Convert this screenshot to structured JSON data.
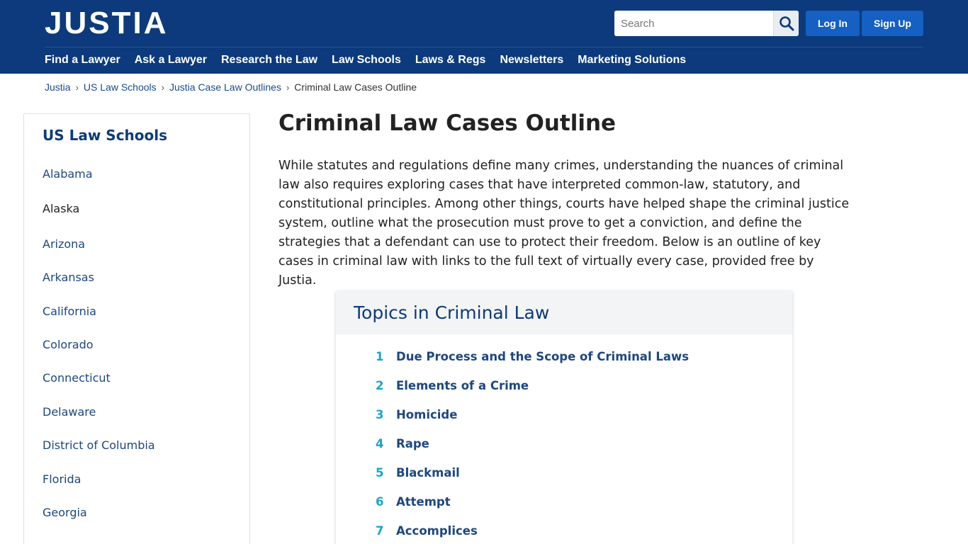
{
  "header": {
    "logo": "JUSTIA",
    "search_placeholder": "Search",
    "login_label": "Log In",
    "signup_label": "Sign Up",
    "nav": [
      "Find a Lawyer",
      "Ask a Lawyer",
      "Research the Law",
      "Law Schools",
      "Laws & Regs",
      "Newsletters",
      "Marketing Solutions"
    ]
  },
  "breadcrumb": [
    "Justia",
    "US Law Schools",
    "Justia Case Law Outlines",
    "Criminal Law Cases Outline"
  ],
  "sidebar": {
    "title": "US Law Schools",
    "items": [
      "Alabama",
      "Alaska",
      "Arizona",
      "Arkansas",
      "California",
      "Colorado",
      "Connecticut",
      "Delaware",
      "District of Columbia",
      "Florida",
      "Georgia"
    ]
  },
  "main": {
    "title": "Criminal Law Cases Outline",
    "intro": "While statutes and regulations define many crimes, understanding the nuances of criminal law also requires exploring cases that have interpreted common-law, statutory, and constitutional principles. Among other things, courts have helped shape the criminal justice system, outline what the prosecution must prove to get a conviction, and define the strategies that a defendant can use to protect their freedom. Below is an outline of key cases in criminal law with links to the full text of virtually every case, provided free by Justia."
  },
  "topics": {
    "heading": "Topics in Criminal Law",
    "items": [
      {
        "num": "1",
        "label": "Due Process and the Scope of Criminal Laws"
      },
      {
        "num": "2",
        "label": "Elements of a Crime"
      },
      {
        "num": "3",
        "label": "Homicide"
      },
      {
        "num": "4",
        "label": "Rape"
      },
      {
        "num": "5",
        "label": "Blackmail"
      },
      {
        "num": "6",
        "label": "Attempt"
      },
      {
        "num": "7",
        "label": "Accomplices"
      }
    ]
  },
  "colors": {
    "header_bg": "#0c3a7c",
    "button_bg": "#1560c2",
    "link": "#1d4780",
    "topic_number": "#19a4d1"
  }
}
